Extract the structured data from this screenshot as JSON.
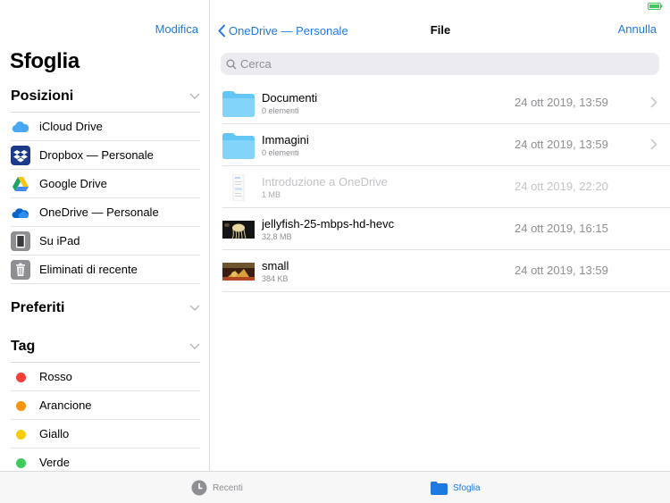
{
  "sidebar": {
    "edit_label": "Modifica",
    "title": "Sfoglia",
    "locations": {
      "header": "Posizioni",
      "items": [
        {
          "label": "iCloud Drive",
          "icon": "icloud-icon"
        },
        {
          "label": "Dropbox — Personale",
          "icon": "dropbox-icon"
        },
        {
          "label": "Google Drive",
          "icon": "google-drive-icon"
        },
        {
          "label": "OneDrive — Personale",
          "icon": "onedrive-icon"
        },
        {
          "label": "Su iPad",
          "icon": "ipad-icon"
        },
        {
          "label": "Eliminati di recente",
          "icon": "trash-icon"
        }
      ]
    },
    "favorites": {
      "header": "Preferiti"
    },
    "tags": {
      "header": "Tag",
      "items": [
        {
          "label": "Rosso",
          "color": "#f2403a"
        },
        {
          "label": "Arancione",
          "color": "#f5950f"
        },
        {
          "label": "Giallo",
          "color": "#f7cd0e"
        },
        {
          "label": "Verde",
          "color": "#3fcb5b"
        }
      ]
    }
  },
  "main": {
    "back_label": "OneDrive — Personale",
    "title": "File",
    "cancel_label": "Annulla",
    "search_placeholder": "Cerca",
    "files": [
      {
        "name": "Documenti",
        "meta": "0 elementi",
        "date": "24 ott 2019, 13:59",
        "type": "folder"
      },
      {
        "name": "Immagini",
        "meta": "0 elementi",
        "date": "24 ott 2019, 13:59",
        "type": "folder"
      },
      {
        "name": "Introduzione a OneDrive",
        "meta": "1 MB",
        "date": "24 ott 2019, 22:20",
        "type": "document"
      },
      {
        "name": "jellyfish-25-mbps-hd-hevc",
        "meta": "32,8 MB",
        "date": "24 ott 2019, 16:15",
        "type": "video"
      },
      {
        "name": "small",
        "meta": "384 KB",
        "date": "24 ott 2019, 13:59",
        "type": "video"
      }
    ]
  },
  "tabbar": {
    "tabs": [
      {
        "label": "Recenti",
        "icon": "clock-icon",
        "active": false
      },
      {
        "label": "Sfoglia",
        "icon": "folder-icon",
        "active": true
      }
    ]
  },
  "colors": {
    "accent": "#1f7ae0",
    "folder": "#63c6f5",
    "battery": "#3fcb5b"
  }
}
